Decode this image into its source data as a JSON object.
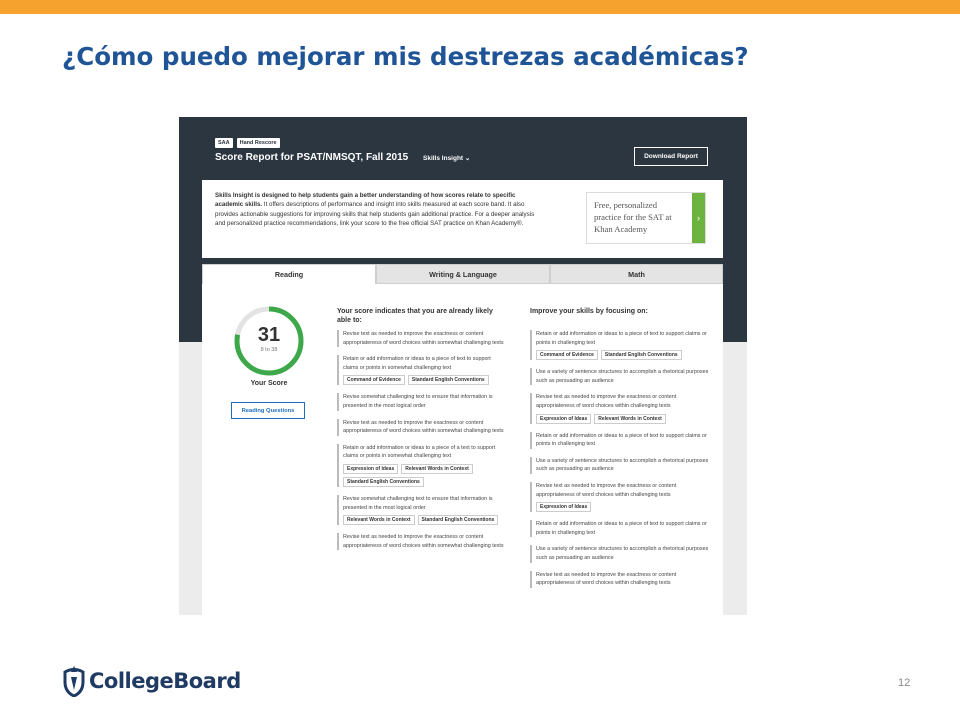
{
  "slide": {
    "title": "¿Cómo puedo mejorar mis destrezas académicas?",
    "page_number": "12",
    "logo_text": "CollegeBoard",
    "accent_color": "#f5a22e",
    "title_color": "#1f5496"
  },
  "report": {
    "badges": [
      "SAA",
      "Hand Rescore"
    ],
    "title": "Score Report for PSAT/NMSQT, Fall 2015",
    "skills_dropdown": "Skills Insight",
    "download_label": "Download Report",
    "intro_bold": "Skills Insight is designed to help students gain a better understanding of how scores relate to specific academic skills.",
    "intro_rest": " It offers descriptions of performance and insight into skills measured at each score band.  It also provides actionable suggestions for improving skills that help students gain additional practice.  For a deeper analysis and personalized practice recommendations, link your score to the free official SAT practice on Khan Academy®.",
    "khan_text": "Free, personalized practice for the SAT at Khan Academy",
    "tabs": [
      "Reading",
      "Writing & Language",
      "Math"
    ],
    "score": {
      "value": "31",
      "range": "8 to 38",
      "label": "Your Score",
      "ring_fill": 0.78
    },
    "reading_questions_label": "Reading Questions",
    "able_heading": "Your score indicates that you are already likely able to:",
    "improve_heading": "Improve your skills by focusing on:",
    "able_items": [
      {
        "text": "Revise text as needed to improve the exactness or content appropriateness of word choices within somewhat challenging texts",
        "tags": []
      },
      {
        "text": "Retain or add information or ideas to a piece of text to support claims or points in somewhat challenging text",
        "tags": [
          "Command of Evidence",
          "Standard English Conventions"
        ]
      },
      {
        "text": "Revise somewhat challenging text to ensure that information is presented in the most logical order",
        "tags": []
      },
      {
        "text": "Revise text as needed to improve the exactness or content appropriateness of word choices within somewhat challenging texts",
        "tags": []
      },
      {
        "text": "Retain or add information or ideas to a piece of a text to support claims or points in somewhat challenging text",
        "tags": [
          "Expression of Ideas",
          "Relevant Words in Context",
          "Standard English Conventions"
        ]
      },
      {
        "text": "Revise somewhat challenging text to ensure that information is presented in the most logical order",
        "tags": [
          "Relevant Words in Context",
          "Standard English Conventions"
        ]
      },
      {
        "text": "Revise text as needed to improve the exactness or content appropriateness of word choices within somewhat challenging texts",
        "tags": []
      }
    ],
    "improve_items": [
      {
        "text": "Retain or add information or ideas to a piece of text to support claims or points in challenging text",
        "tags": [
          "Command of Evidence",
          "Standard English Conventions"
        ]
      },
      {
        "text": "Use a variety of sentence structures to accomplish a rhetorical purposes such as persuading an audience",
        "tags": []
      },
      {
        "text": "Revise text as needed to improve the exactness or content appropriateness of word choices within challenging texts",
        "tags": [
          "Expression of Ideas",
          "Relevant Words in Context"
        ]
      },
      {
        "text": "Retain or add information or ideas to a piece of text to support claims or points in challenging text",
        "tags": []
      },
      {
        "text": "Use a variety of sentence structures to accomplish a rhetorical purposes such as persuading an audience",
        "tags": []
      },
      {
        "text": "Revise text as needed to improve the exactness or content appropriateness of word choices within challenging texts",
        "tags": [
          "Expression of Ideas"
        ]
      },
      {
        "text": "Retain or add information or ideas to a piece of text to support claims or points in challenging text",
        "tags": []
      },
      {
        "text": "Use a variety of sentence structures to accomplish a rhetorical purposes such as persuading an audience",
        "tags": []
      },
      {
        "text": "Revise text as needed to improve the exactness or content appropriateness of word choices within challenging texts",
        "tags": []
      }
    ]
  }
}
